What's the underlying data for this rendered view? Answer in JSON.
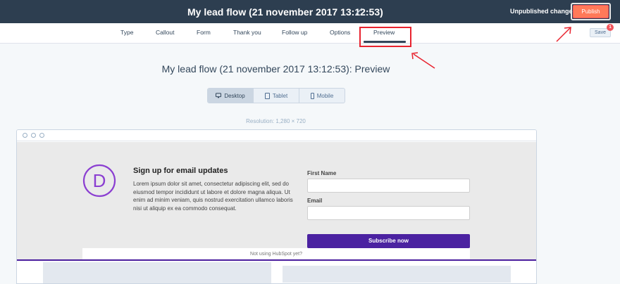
{
  "header": {
    "title": "My lead flow (21 november 2017 13:12:53)",
    "status": "Unpublished changes",
    "publish_label": "Publish"
  },
  "tabs": [
    {
      "label": "Type"
    },
    {
      "label": "Callout"
    },
    {
      "label": "Form"
    },
    {
      "label": "Thank you"
    },
    {
      "label": "Follow up"
    },
    {
      "label": "Options"
    },
    {
      "label": "Preview"
    }
  ],
  "active_tab": "Preview",
  "save": {
    "label": "Save",
    "badge": "1"
  },
  "preview": {
    "title": "My lead flow (21 november 2017 13:12:53): Preview",
    "devices": [
      {
        "label": "Desktop",
        "icon": "desktop-icon"
      },
      {
        "label": "Tablet",
        "icon": "tablet-icon"
      },
      {
        "label": "Mobile",
        "icon": "mobile-icon"
      }
    ],
    "resolution": "Resolution: 1,280 × 720"
  },
  "leadflow": {
    "logo_letter": "D",
    "heading": "Sign up for email updates",
    "body": "Lorem ipsum dolor sit amet, consectetur adipiscing elit, sed do eiusmod tempor incididunt ut labore et dolore magna aliqua. Ut enim ad minim veniam, quis nostrud exercitation ullamco laboris nisi ut aliquip ex ea commodo consequat.",
    "first_name_label": "First Name",
    "email_label": "Email",
    "button": "Subscribe now",
    "footer": "Not using HubSpot yet?"
  },
  "colors": {
    "header_bg": "#2d3e50",
    "publish": "#ff7a59",
    "annotation": "#e8232f",
    "brand_purple": "#4b22a1",
    "logo_purple": "#8b3fd1"
  }
}
